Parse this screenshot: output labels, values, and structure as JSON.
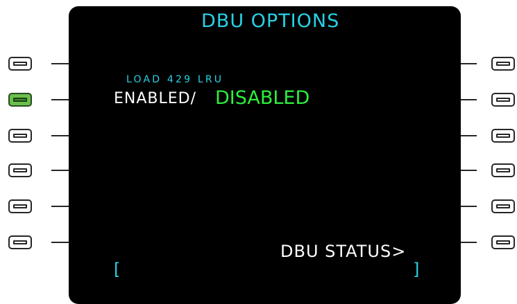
{
  "page": {
    "title": "DBU OPTIONS"
  },
  "lines": {
    "load_label": "LOAD 429 LRU",
    "enable_label": "ENABLED/",
    "disable_label": "DISABLED",
    "status_label": "DBU STATUS>",
    "bracket_left": "[",
    "bracket_right": "]"
  },
  "colors": {
    "screen": "#000000",
    "cyan": "#28d2e6",
    "white": "#ffffff",
    "green": "#2cf03c",
    "active_key": "#6abf4b"
  }
}
